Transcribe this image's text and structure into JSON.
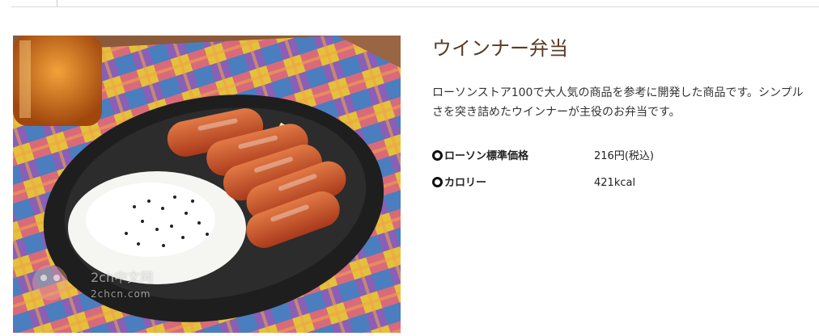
{
  "product": {
    "title": "ウインナー弁当",
    "description": "ローソンストア100で大人気の商品を参考に開発した商品です。シンプルさを突き詰めたウインナーが主役のお弁当です。"
  },
  "specs": [
    {
      "label": "ローソン標準価格",
      "value": "216円(税込)"
    },
    {
      "label": "カロリー",
      "value": "421kcal"
    }
  ],
  "watermark": {
    "line1": "2ch中文网",
    "line2": "2chcn.com"
  },
  "colors": {
    "title": "#5a3a22",
    "rule": "#dcdcdc",
    "tray": "#1e1e1e",
    "rice": "#f5f5f2",
    "sausage": "#c8562e"
  }
}
